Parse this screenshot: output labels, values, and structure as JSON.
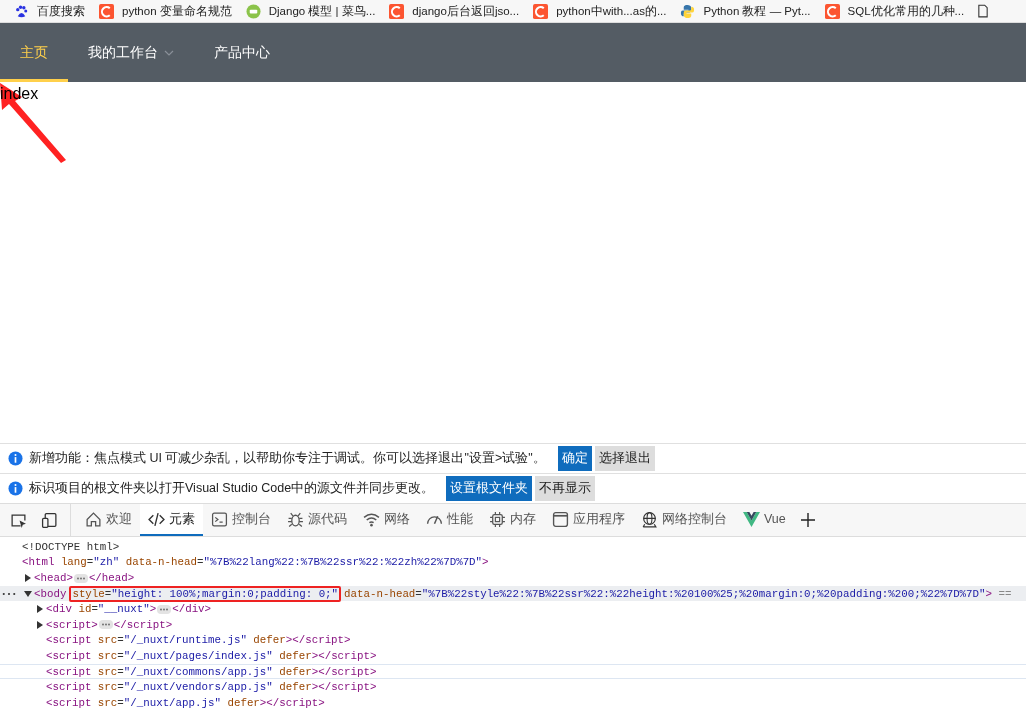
{
  "bookmarks": [
    {
      "kind": "paw",
      "label": "百度搜索"
    },
    {
      "kind": "c-square",
      "label": "python 变量命名规范"
    },
    {
      "kind": "green-badge",
      "label": "Django 模型 | 菜鸟..."
    },
    {
      "kind": "c-square",
      "label": "django后台返回jso..."
    },
    {
      "kind": "c-square",
      "label": "python中with...as的..."
    },
    {
      "kind": "twin-snake",
      "label": "Python 教程 — Pyt..."
    },
    {
      "kind": "c-square",
      "label": "SQL优化常用的几种..."
    }
  ],
  "nav": {
    "items": [
      {
        "label": "主页",
        "selected": true,
        "has_menu": false
      },
      {
        "label": "我的工作台",
        "selected": false,
        "has_menu": true
      },
      {
        "label": "产品中心",
        "selected": false,
        "has_menu": false
      }
    ]
  },
  "page": {
    "text": "index"
  },
  "notices": [
    {
      "text": "新增功能：焦点模式 UI 可减少杂乱，以帮助你专注于调试。你可以选择退出\"设置>试验\"。",
      "buttons": [
        {
          "label": "确定",
          "kind": "primary"
        },
        {
          "label": "选择退出",
          "kind": "secondary"
        }
      ]
    },
    {
      "text": "标识项目的根文件夹以打开Visual Studio Code中的源文件并同步更改。",
      "buttons": [
        {
          "label": "设置根文件夹",
          "kind": "primary"
        },
        {
          "label": "不再显示",
          "kind": "secondary"
        }
      ]
    }
  ],
  "devtools": {
    "tabs": [
      {
        "kind": "home",
        "label": "欢迎",
        "selected": false
      },
      {
        "kind": "code",
        "label": "元素",
        "selected": true
      },
      {
        "kind": "console",
        "label": "控制台",
        "selected": false
      },
      {
        "kind": "bug",
        "label": "源代码",
        "selected": false
      },
      {
        "kind": "wifi",
        "label": "网络",
        "selected": false
      },
      {
        "kind": "gauge",
        "label": "性能",
        "selected": false
      },
      {
        "kind": "chip",
        "label": "内存",
        "selected": false
      },
      {
        "kind": "window",
        "label": "应用程序",
        "selected": false
      },
      {
        "kind": "globe",
        "label": "网络控制台",
        "selected": false
      },
      {
        "kind": "vue",
        "label": "Vue",
        "selected": false
      }
    ],
    "dom_tree": [
      {
        "kind": "line",
        "selected": false,
        "hovered": false,
        "segs": [
          {
            "kind": "doctype",
            "text": "<!DOCTYPE html>"
          }
        ]
      },
      {
        "kind": "line",
        "selected": false,
        "hovered": false,
        "segs": [
          {
            "kind": "tag",
            "text": "<html"
          },
          {
            "kind": "attr",
            "text": " lang"
          },
          {
            "kind": "punct",
            "text": "="
          },
          {
            "kind": "value",
            "text": "\"zh\""
          },
          {
            "kind": "attr",
            "text": " data-n-head"
          },
          {
            "kind": "punct",
            "text": "="
          },
          {
            "kind": "value",
            "text": "\"%7B%22lang%22:%7B%22ssr%22:%22zh%22%7D%7D\""
          },
          {
            "kind": "tag",
            "text": ">"
          }
        ],
        "children": [
          {
            "kind": "toggle",
            "expanded": false,
            "selected": false,
            "hovered": false,
            "segs": [
              {
                "kind": "tag",
                "text": "<head>"
              }
            ],
            "close": [
              {
                "kind": "tag",
                "text": "</head>"
              }
            ]
          },
          {
            "kind": "toggle",
            "expanded": true,
            "selected": true,
            "hovered": false,
            "segs": [
              {
                "kind": "tag",
                "text": "<body"
              },
              {
                "kind": "boxed",
                "segs": [
                  {
                    "kind": "attr",
                    "text": "style"
                  },
                  {
                    "kind": "punct",
                    "text": "="
                  },
                  {
                    "kind": "value",
                    "text": "\"height: 100%;margin:0;padding: 0;\""
                  }
                ]
              },
              {
                "kind": "attr",
                "text": "data-n-head"
              },
              {
                "kind": "punct",
                "text": "="
              },
              {
                "kind": "value",
                "text": "\"%7B%22style%22:%7B%22ssr%22:%22height:%20100%25;%20margin:0;%20padding:%200;%22%7D%7D\""
              },
              {
                "kind": "tag",
                "text": ">"
              },
              {
                "kind": "muted",
                "text": " =="
              }
            ],
            "children": [
              {
                "kind": "toggle",
                "expanded": false,
                "selected": false,
                "hovered": false,
                "segs": [
                  {
                    "kind": "tag",
                    "text": "<div"
                  },
                  {
                    "kind": "attr",
                    "text": " id"
                  },
                  {
                    "kind": "punct",
                    "text": "="
                  },
                  {
                    "kind": "value",
                    "text": "\"__nuxt\""
                  },
                  {
                    "kind": "tag",
                    "text": ">"
                  }
                ],
                "close": [
                  {
                    "kind": "tag",
                    "text": "</div>"
                  }
                ]
              },
              {
                "kind": "toggle",
                "expanded": false,
                "selected": false,
                "hovered": false,
                "segs": [
                  {
                    "kind": "tag",
                    "text": "<script>"
                  }
                ],
                "close": [
                  {
                    "kind": "tag",
                    "text": "</script>"
                  }
                ]
              },
              {
                "kind": "line",
                "selected": false,
                "hovered": false,
                "segs": [
                  {
                    "kind": "tag",
                    "text": "<script"
                  },
                  {
                    "kind": "attr",
                    "text": " src"
                  },
                  {
                    "kind": "punct",
                    "text": "="
                  },
                  {
                    "kind": "value",
                    "text": "\"/_nuxt/runtime.js\""
                  },
                  {
                    "kind": "attr",
                    "text": " defer"
                  },
                  {
                    "kind": "tag",
                    "text": "></script>"
                  }
                ]
              },
              {
                "kind": "line",
                "selected": false,
                "hovered": false,
                "segs": [
                  {
                    "kind": "tag",
                    "text": "<script"
                  },
                  {
                    "kind": "attr",
                    "text": " src"
                  },
                  {
                    "kind": "punct",
                    "text": "="
                  },
                  {
                    "kind": "value",
                    "text": "\"/_nuxt/pages/index.js\""
                  },
                  {
                    "kind": "attr",
                    "text": " defer"
                  },
                  {
                    "kind": "tag",
                    "text": "></script>"
                  }
                ]
              },
              {
                "kind": "line",
                "selected": false,
                "hovered": true,
                "segs": [
                  {
                    "kind": "tag",
                    "text": "<script"
                  },
                  {
                    "kind": "attr",
                    "text": " src"
                  },
                  {
                    "kind": "punct",
                    "text": "="
                  },
                  {
                    "kind": "value",
                    "text": "\"/_nuxt/commons/app.js\""
                  },
                  {
                    "kind": "attr",
                    "text": " defer"
                  },
                  {
                    "kind": "tag",
                    "text": "></script>"
                  }
                ]
              },
              {
                "kind": "line",
                "selected": false,
                "hovered": false,
                "segs": [
                  {
                    "kind": "tag",
                    "text": "<script"
                  },
                  {
                    "kind": "attr",
                    "text": " src"
                  },
                  {
                    "kind": "punct",
                    "text": "="
                  },
                  {
                    "kind": "value",
                    "text": "\"/_nuxt/vendors/app.js\""
                  },
                  {
                    "kind": "attr",
                    "text": " defer"
                  },
                  {
                    "kind": "tag",
                    "text": "></script>"
                  }
                ]
              },
              {
                "kind": "line",
                "selected": false,
                "hovered": false,
                "segs": [
                  {
                    "kind": "tag",
                    "text": "<script"
                  },
                  {
                    "kind": "attr",
                    "text": " src"
                  },
                  {
                    "kind": "punct",
                    "text": "="
                  },
                  {
                    "kind": "value",
                    "text": "\"/_nuxt/app.js\""
                  },
                  {
                    "kind": "attr",
                    "text": " defer"
                  },
                  {
                    "kind": "tag",
                    "text": "></script>"
                  }
                ]
              }
            ]
          }
        ]
      }
    ]
  }
}
